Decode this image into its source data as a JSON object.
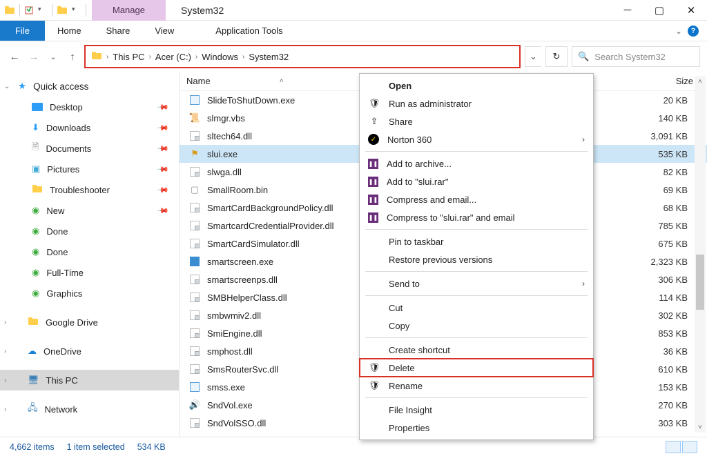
{
  "window": {
    "title": "System32",
    "manage_tab": "Manage",
    "app_tools": "Application Tools"
  },
  "ribbon": {
    "file": "File",
    "home": "Home",
    "share": "Share",
    "view": "View"
  },
  "breadcrumb": {
    "this_pc": "This PC",
    "drive": "Acer (C:)",
    "windows": "Windows",
    "system32": "System32"
  },
  "search": {
    "placeholder": "Search System32"
  },
  "columns": {
    "name": "Name",
    "size": "Size"
  },
  "nav": {
    "quick_access": "Quick access",
    "desktop": "Desktop",
    "downloads": "Downloads",
    "documents": "Documents",
    "pictures": "Pictures",
    "troubleshooter": "Troubleshooter",
    "new": "New",
    "done1": "Done",
    "done2": "Done",
    "fulltime": "Full-Time",
    "graphics": "Graphics",
    "google_drive": "Google Drive",
    "onedrive": "OneDrive",
    "this_pc": "This PC",
    "network": "Network"
  },
  "files": [
    {
      "name": "SlideToShutDown.exe",
      "size": "20 KB",
      "icon": "exe"
    },
    {
      "name": "slmgr.vbs",
      "size": "140 KB",
      "icon": "vbs"
    },
    {
      "name": "sltech64.dll",
      "size": "3,091 KB",
      "icon": "dll"
    },
    {
      "name": "slui.exe",
      "size": "535 KB",
      "icon": "exe-flag",
      "selected": true
    },
    {
      "name": "slwga.dll",
      "size": "82 KB",
      "icon": "dll"
    },
    {
      "name": "SmallRoom.bin",
      "size": "69 KB",
      "icon": "bin"
    },
    {
      "name": "SmartCardBackgroundPolicy.dll",
      "size": "68 KB",
      "icon": "dll"
    },
    {
      "name": "SmartcardCredentialProvider.dll",
      "size": "785 KB",
      "icon": "dll"
    },
    {
      "name": "SmartCardSimulator.dll",
      "size": "675 KB",
      "icon": "dll"
    },
    {
      "name": "smartscreen.exe",
      "size": "2,323 KB",
      "icon": "exe-shield"
    },
    {
      "name": "smartscreenps.dll",
      "size": "306 KB",
      "icon": "dll"
    },
    {
      "name": "SMBHelperClass.dll",
      "size": "114 KB",
      "icon": "dll"
    },
    {
      "name": "smbwmiv2.dll",
      "size": "302 KB",
      "icon": "dll"
    },
    {
      "name": "SmiEngine.dll",
      "size": "853 KB",
      "icon": "dll"
    },
    {
      "name": "smphost.dll",
      "size": "36 KB",
      "icon": "dll"
    },
    {
      "name": "SmsRouterSvc.dll",
      "size": "610 KB",
      "icon": "dll"
    },
    {
      "name": "smss.exe",
      "size": "153 KB",
      "icon": "exe"
    },
    {
      "name": "SndVol.exe",
      "size": "270 KB",
      "icon": "exe-vol"
    },
    {
      "name": "SndVolSSO.dll",
      "size": "303 KB",
      "icon": "dll"
    }
  ],
  "context": {
    "open": "Open",
    "run_admin": "Run as administrator",
    "share": "Share",
    "norton": "Norton 360",
    "add_archive": "Add to archive...",
    "add_rar": "Add to \"slui.rar\"",
    "compress_email": "Compress and email...",
    "compress_rar_email": "Compress to \"slui.rar\" and email",
    "pin_taskbar": "Pin to taskbar",
    "restore": "Restore previous versions",
    "send_to": "Send to",
    "cut": "Cut",
    "copy": "Copy",
    "create_shortcut": "Create shortcut",
    "delete": "Delete",
    "rename": "Rename",
    "file_insight": "File Insight",
    "properties": "Properties"
  },
  "status": {
    "items": "4,662 items",
    "selected": "1 item selected",
    "size": "534 KB"
  }
}
